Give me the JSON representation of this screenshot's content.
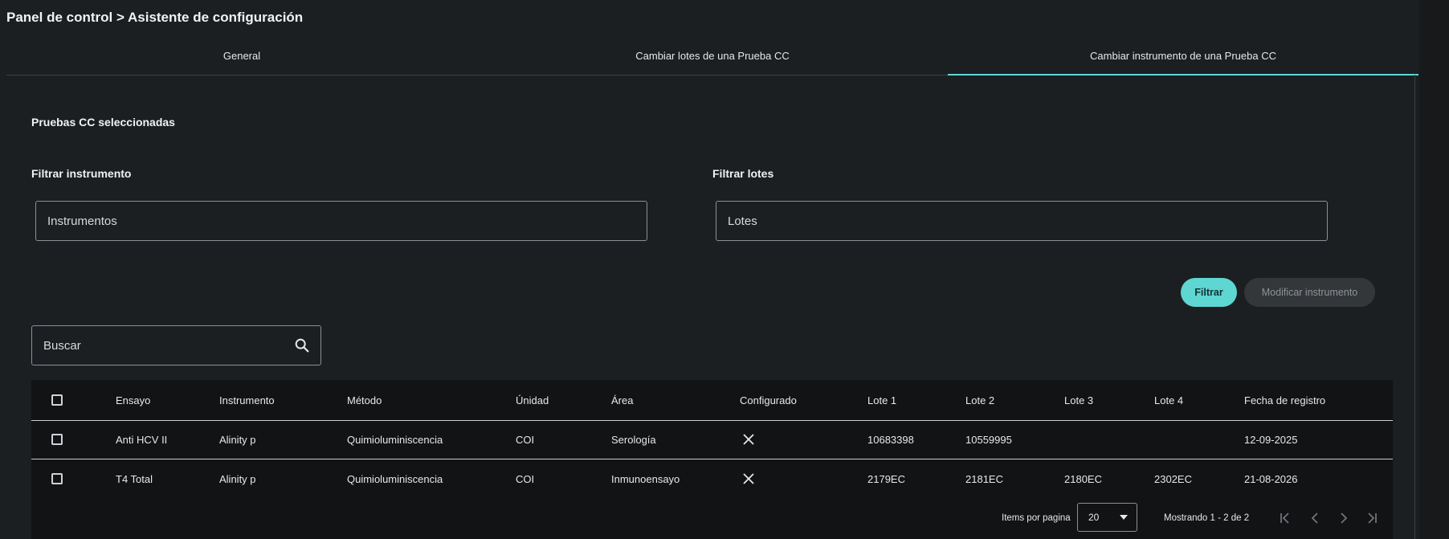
{
  "breadcrumb": "Panel de control > Asistente de configuración",
  "tabs": [
    {
      "label": "General",
      "active": false
    },
    {
      "label": "Cambiar lotes de una Prueba CC",
      "active": false
    },
    {
      "label": "Cambiar instrumento de una Prueba CC",
      "active": true
    }
  ],
  "section_title": "Pruebas CC seleccionadas",
  "filters": {
    "instrument_label": "Filtrar instrumento",
    "instrument_placeholder": "Instrumentos",
    "lots_label": "Filtrar lotes",
    "lots_placeholder": "Lotes"
  },
  "buttons": {
    "filter": "Filtrar",
    "modify": "Modificar instrumento"
  },
  "search": {
    "placeholder": "Buscar"
  },
  "table": {
    "columns": [
      "Ensayo",
      "Instrumento",
      "Método",
      "Únidad",
      "Área",
      "Configurado",
      "Lote 1",
      "Lote 2",
      "Lote 3",
      "Lote 4",
      "Fecha de registro"
    ],
    "rows": [
      {
        "ensayo": "Anti HCV II",
        "instrumento": "Alinity p",
        "metodo": "Quimioluminiscencia",
        "unidad": "COI",
        "area": "Serología",
        "configurado": "close-icon",
        "lote1": "10683398",
        "lote2": "10559995",
        "lote3": "",
        "lote4": "",
        "fecha": "12-09-2025"
      },
      {
        "ensayo": "T4 Total",
        "instrumento": "Alinity p",
        "metodo": "Quimioluminiscencia",
        "unidad": "COI",
        "area": "Inmunoensayo",
        "configurado": "close-icon",
        "lote1": "2179EC",
        "lote2": "2181EC",
        "lote3": "2180EC",
        "lote4": "2302EC",
        "fecha": "21-08-2026"
      }
    ]
  },
  "pagination": {
    "items_label": "Items por pagina",
    "page_size": "20",
    "range_text": "Mostrando 1 - 2 de 2"
  },
  "colors": {
    "accent": "#5ed6d2",
    "background": "#1b1f22",
    "table_bg": "#111315"
  }
}
